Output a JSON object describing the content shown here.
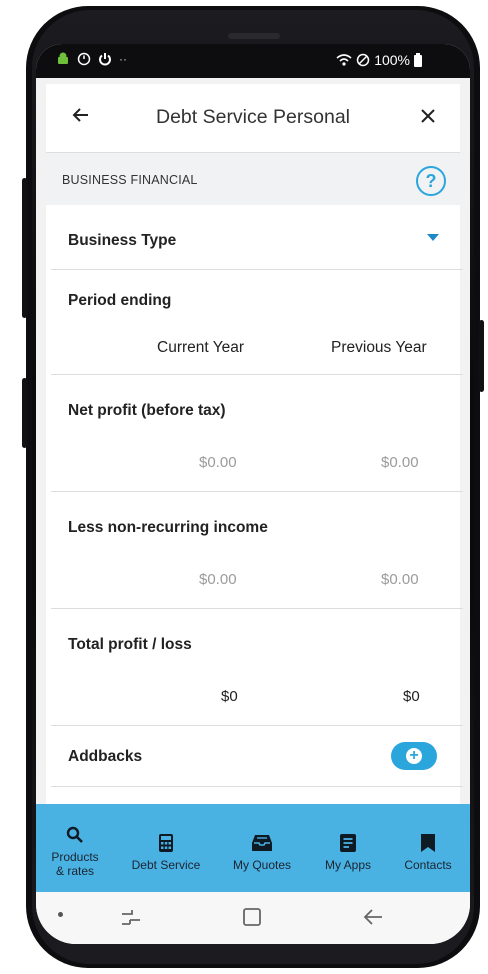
{
  "status_bar": {
    "battery": "100%"
  },
  "header": {
    "title": "Debt Service Personal",
    "back_icon": "arrow-left-icon",
    "close_icon": "close-icon"
  },
  "section": {
    "label": "BUSINESS FINANCIAL",
    "help_icon": "help-icon"
  },
  "business_type": {
    "label": "Business Type"
  },
  "period": {
    "label": "Period ending",
    "current": "Current Year",
    "previous": "Previous Year"
  },
  "rows": [
    {
      "label": "Net profit (before tax)",
      "current": "$0.00",
      "previous": "$0.00"
    },
    {
      "label": "Less non-recurring income",
      "current": "$0.00",
      "previous": "$0.00"
    },
    {
      "label": "Total profit / loss",
      "current": "$0",
      "previous": "$0"
    }
  ],
  "addbacks": {
    "label": "Addbacks",
    "button_icon": "plus-circle-icon"
  },
  "tabs": [
    {
      "label": "Products\n& rates",
      "icon": "search-icon"
    },
    {
      "label": "Debt Service",
      "icon": "calculator-icon"
    },
    {
      "label": "My Quotes",
      "icon": "inbox-icon"
    },
    {
      "label": "My Apps",
      "icon": "document-icon"
    },
    {
      "label": "Contacts",
      "icon": "bookmark-icon"
    }
  ],
  "colors": {
    "accent": "#2aa6dd",
    "tabbar": "#4ab1e3",
    "caret": "#1e88c8"
  }
}
